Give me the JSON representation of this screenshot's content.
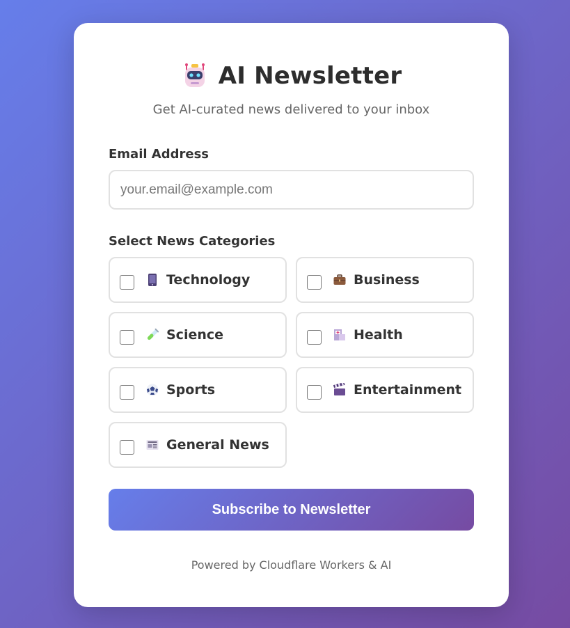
{
  "header": {
    "icon": "robot-icon",
    "title": "AI Newsletter",
    "subtitle": "Get AI-curated news delivered to your inbox"
  },
  "email": {
    "label": "Email Address",
    "placeholder": "your.email@example.com",
    "value": ""
  },
  "categories": {
    "label": "Select News Categories",
    "items": [
      {
        "label": "Technology",
        "icon": "mobile-phone-icon",
        "checked": false
      },
      {
        "label": "Business",
        "icon": "briefcase-icon",
        "checked": false
      },
      {
        "label": "Science",
        "icon": "test-tube-icon",
        "checked": false
      },
      {
        "label": "Health",
        "icon": "hospital-icon",
        "checked": false
      },
      {
        "label": "Sports",
        "icon": "soccer-ball-icon",
        "checked": false
      },
      {
        "label": "Entertainment",
        "icon": "clapper-board-icon",
        "checked": false
      },
      {
        "label": "General News",
        "icon": "newspaper-icon",
        "checked": false
      }
    ]
  },
  "subscribe": {
    "label": "Subscribe to Newsletter"
  },
  "footer": {
    "text": "Powered by Cloudflare Workers & AI"
  },
  "colors": {
    "gradient_start": "#667eea",
    "gradient_end": "#764ba2",
    "card_bg": "#ffffff",
    "border": "#e1e1e1"
  }
}
